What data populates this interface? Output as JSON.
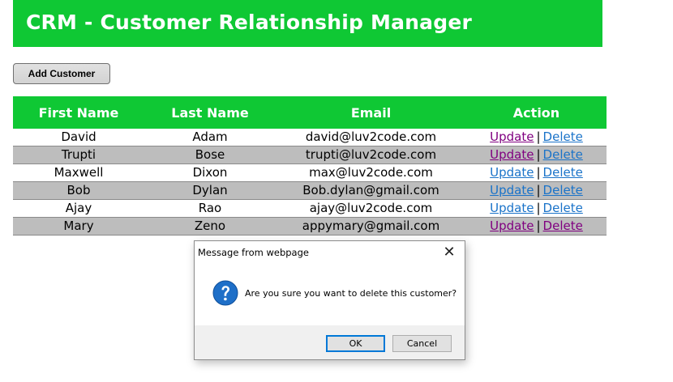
{
  "header": {
    "title": "CRM - Customer Relationship Manager"
  },
  "toolbar": {
    "add_label": "Add Customer"
  },
  "table": {
    "columns": [
      "First Name",
      "Last Name",
      "Email",
      "Action"
    ],
    "rows": [
      {
        "first": "David",
        "last": "Adam",
        "email": "david@luv2code.com",
        "update": "Update",
        "delete": "Delete"
      },
      {
        "first": "Trupti",
        "last": "Bose",
        "email": "trupti@luv2code.com",
        "update": "Update",
        "delete": "Delete"
      },
      {
        "first": "Maxwell",
        "last": "Dixon",
        "email": "max@luv2code.com",
        "update": "Update",
        "delete": "Delete"
      },
      {
        "first": "Bob",
        "last": "Dylan",
        "email": "Bob.dylan@gmail.com",
        "update": "Update",
        "delete": "Delete"
      },
      {
        "first": "Ajay",
        "last": "Rao",
        "email": "ajay@luv2code.com",
        "update": "Update",
        "delete": "Delete"
      },
      {
        "first": "Mary",
        "last": "Zeno",
        "email": "appymary@gmail.com",
        "update": "Update",
        "delete": "Delete"
      }
    ],
    "separator": "|"
  },
  "dialog": {
    "title": "Message from webpage",
    "close_glyph": "✕",
    "icon": "question-icon",
    "message": "Are you sure you want to delete this customer?",
    "ok_label": "OK",
    "cancel_label": "Cancel"
  },
  "colors": {
    "header_bg": "#0fc834",
    "row_alt_bg": "#bdbdbd",
    "link_visited": "#800080",
    "link_unvisited": "#1a73c9",
    "dialog_icon": "#1e6fc8"
  }
}
